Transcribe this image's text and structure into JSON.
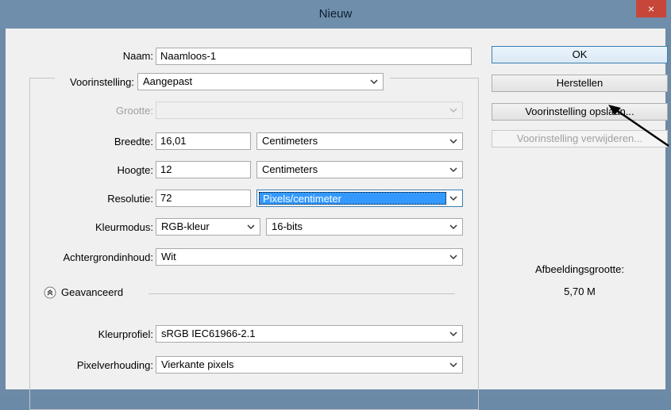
{
  "window": {
    "title": "Nieuw",
    "close_label": "×"
  },
  "form": {
    "naam": {
      "label": "Naam:",
      "value": "Naamloos-1"
    },
    "voorinstelling": {
      "label": "Voorinstelling:",
      "value": "Aangepast"
    },
    "grootte": {
      "label": "Grootte:",
      "value": ""
    },
    "breedte": {
      "label": "Breedte:",
      "value": "16,01",
      "unit": "Centimeters"
    },
    "hoogte": {
      "label": "Hoogte:",
      "value": "12",
      "unit": "Centimeters"
    },
    "resolutie": {
      "label": "Resolutie:",
      "value": "72",
      "unit": "Pixels/centimeter"
    },
    "kleurmodus": {
      "label": "Kleurmodus:",
      "mode": "RGB-kleur",
      "depth": "16-bits"
    },
    "achtergrond": {
      "label": "Achtergrondinhoud:",
      "value": "Wit"
    },
    "geavanceerd": {
      "label": "Geavanceerd"
    },
    "kleurprofiel": {
      "label": "Kleurprofiel:",
      "value": "sRGB IEC61966-2.1"
    },
    "pixelverhouding": {
      "label": "Pixelverhouding:",
      "value": "Vierkante pixels"
    }
  },
  "buttons": {
    "ok": "OK",
    "herstellen": "Herstellen",
    "opslaan": "Voorinstelling opslaan...",
    "verwijderen": "Voorinstelling verwijderen..."
  },
  "info": {
    "label": "Afbeeldingsgrootte:",
    "value": "5,70 M"
  },
  "colors": {
    "highlight": "#3399ff",
    "ok_border": "#3c7fb1",
    "title_bar": "#6f8eab",
    "close": "#c7463a"
  }
}
